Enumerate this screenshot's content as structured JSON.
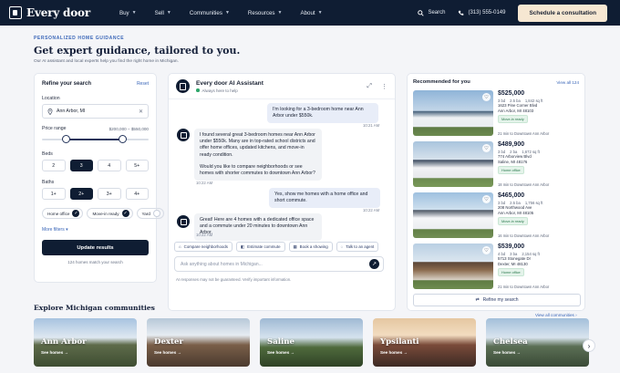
{
  "nav": {
    "brand": "Every door",
    "links": [
      "Buy",
      "Sell",
      "Communities",
      "Resources",
      "About"
    ],
    "search": "Search",
    "phone": "(313) 555-0149",
    "cta": "Schedule a consultation"
  },
  "header": {
    "eyebrow": "PERSONALIZED HOME GUIDANCE",
    "title": "Get expert guidance, tailored to you.",
    "subtitle": "Our AI assistant and local experts help you find the right home in Michigan."
  },
  "filters": {
    "title": "Refine your search",
    "reset": "Reset",
    "location_label": "Location",
    "location_value": "Ann Arbor, MI",
    "price_label": "Price range",
    "price_value": "$200,000 – $550,000",
    "price_min_fraction": 0.22,
    "price_max_fraction": 0.74,
    "beds_label": "Beds",
    "beds": [
      "2",
      "3",
      "4",
      "5+"
    ],
    "beds_selected": "3",
    "baths_label": "Baths",
    "baths": [
      "1+",
      "2+",
      "3+",
      "4+"
    ],
    "baths_selected": "2+",
    "features": [
      {
        "label": "Home office",
        "checked": true
      },
      {
        "label": "Move-in ready",
        "checked": true
      },
      {
        "label": "Yard",
        "checked": false
      }
    ],
    "more": "More filters",
    "update": "Update results",
    "count": "124 homes match your search"
  },
  "chat": {
    "title": "Every door AI Assistant",
    "status": "Always here to help",
    "messages": [
      {
        "from": "user",
        "text": "I'm looking for a 3-bedroom home near Ann Arbor under $550k.",
        "time": "10:21 AM"
      },
      {
        "from": "bot",
        "text": "I found several great 3-bedroom homes near Ann Arbor under $550k. Many are in top-rated school districts and offer home offices, updated kitchens, and move-in ready condition.",
        "text2": "Would you like to compare neighborhoods or see homes with shorter commutes to downtown Ann Arbor?",
        "time": "10:22 AM"
      },
      {
        "from": "user",
        "text": "Yes, show me homes with a home office and short commute.",
        "time": "10:22 AM"
      },
      {
        "from": "bot",
        "text": "Great! Here are 4 homes with a dedicated office space and a commute under 20 minutes to downtown Ann Arbor.",
        "time": "10:22 AM"
      }
    ],
    "quick": [
      "Compare neighborhoods",
      "Estimate commute",
      "Book a showing",
      "Talk to an agent"
    ],
    "placeholder": "Ask anything about homes in Michigan...",
    "disclaimer": "AI responses may not be guaranteed. Verify important information."
  },
  "recs": {
    "title": "Recommended for you",
    "view_all": "View all 124",
    "listings": [
      {
        "price": "$525,000",
        "beds": "3 bd",
        "baths": "2.5 ba",
        "sqft": "1,842 sq ft",
        "addr1": "1623 Pine Corner Blvd",
        "addr2": "Ann Arbor, MI 48103",
        "badge": "Move-in ready",
        "commute": "21 min to Downtown Ann Arbor"
      },
      {
        "price": "$489,900",
        "beds": "3 bd",
        "baths": "2 ba",
        "sqft": "1,672 sq ft",
        "addr1": "774 Arborview Blvd",
        "addr2": "Saline, MI 48176",
        "badge": "Home office",
        "commute": "18 min to Downtown Ann Arbor"
      },
      {
        "price": "$465,000",
        "beds": "3 bd",
        "baths": "2.5 ba",
        "sqft": "1,756 sq ft",
        "addr1": "208 Northwood Ave",
        "addr2": "Ann Arbor, MI 48105",
        "badge": "Move-in ready",
        "commute": "16 min to Downtown Ann Arbor"
      },
      {
        "price": "$539,000",
        "beds": "4 bd",
        "baths": "3 ba",
        "sqft": "2,154 sq ft",
        "addr1": "5713 Stonegate Dr",
        "addr2": "Dexter, MI 48130",
        "badge": "Home office",
        "commute": "21 min to Downtown Ann Arbor"
      }
    ],
    "refine": "Refine my search"
  },
  "communities": {
    "title": "Explore Michigan communities",
    "view_all": "View all communities",
    "see": "See homes",
    "items": [
      "Ann Arbor",
      "Dexter",
      "Saline",
      "Ypsilanti",
      "Chelsea"
    ]
  }
}
